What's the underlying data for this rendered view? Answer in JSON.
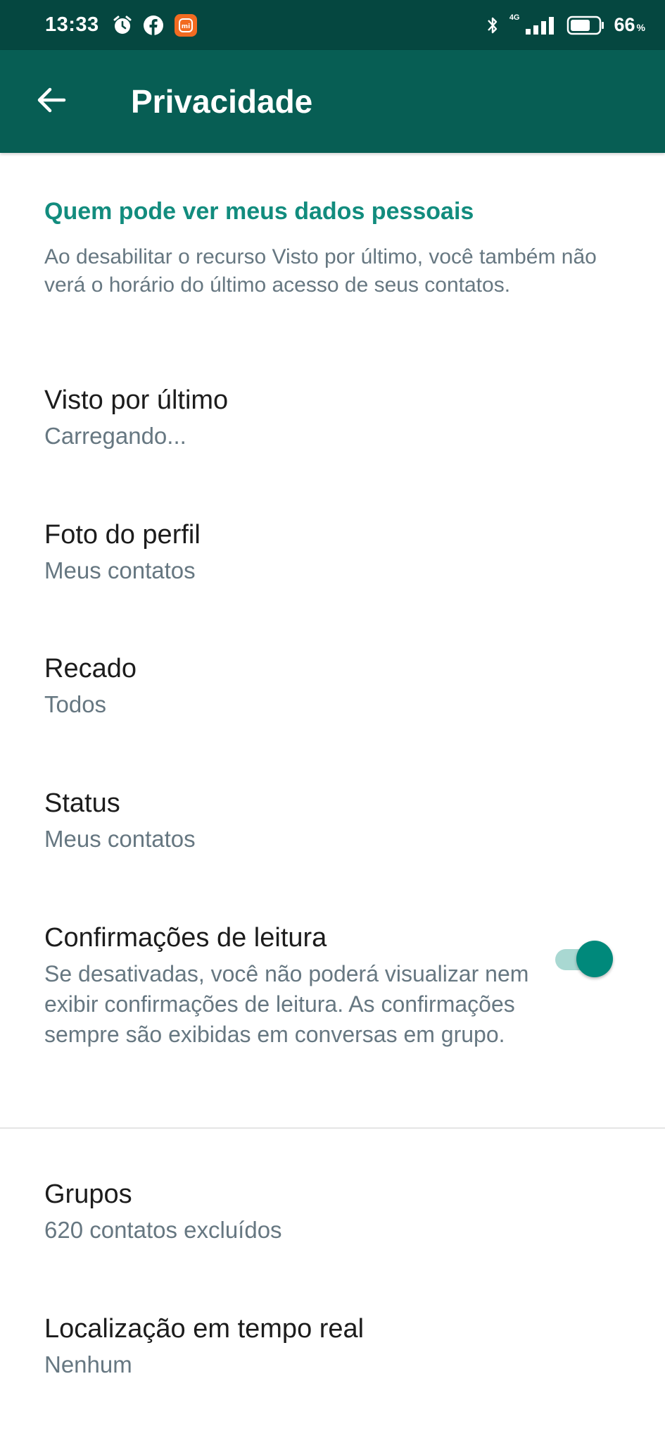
{
  "status_bar": {
    "time": "13:33",
    "network": "4G",
    "battery_percent": "66",
    "battery_unit": "%",
    "icons": [
      "alarm-icon",
      "facebook-icon",
      "mi-app-icon",
      "bluetooth-icon",
      "signal-icon",
      "battery-icon"
    ]
  },
  "app_bar": {
    "title": "Privacidade",
    "back_icon": "arrow-back-icon",
    "color": "#075e54"
  },
  "section": {
    "header": "Quem pode ver meus dados pessoais",
    "description": "Ao desabilitar o recurso Visto por último, você também não verá o horário do último acesso de seus contatos."
  },
  "settings": {
    "last_seen": {
      "title": "Visto por último",
      "value": "Carregando..."
    },
    "profile_photo": {
      "title": "Foto do perfil",
      "value": "Meus contatos"
    },
    "about": {
      "title": "Recado",
      "value": "Todos"
    },
    "status": {
      "title": "Status",
      "value": "Meus contatos"
    },
    "read_receipts": {
      "title": "Confirmações de leitura",
      "description": "Se desativadas, você não poderá visualizar nem exibir confirmações de leitura. As confirmações sempre são exibidas em conversas em grupo.",
      "enabled": true
    },
    "groups": {
      "title": "Grupos",
      "value": "620 contatos excluídos"
    },
    "live_location": {
      "title": "Localização em tempo real",
      "value": "Nenhum"
    }
  },
  "colors": {
    "accent": "#128c7e",
    "toggle_on": "#00897b",
    "status_bar": "#054740"
  }
}
